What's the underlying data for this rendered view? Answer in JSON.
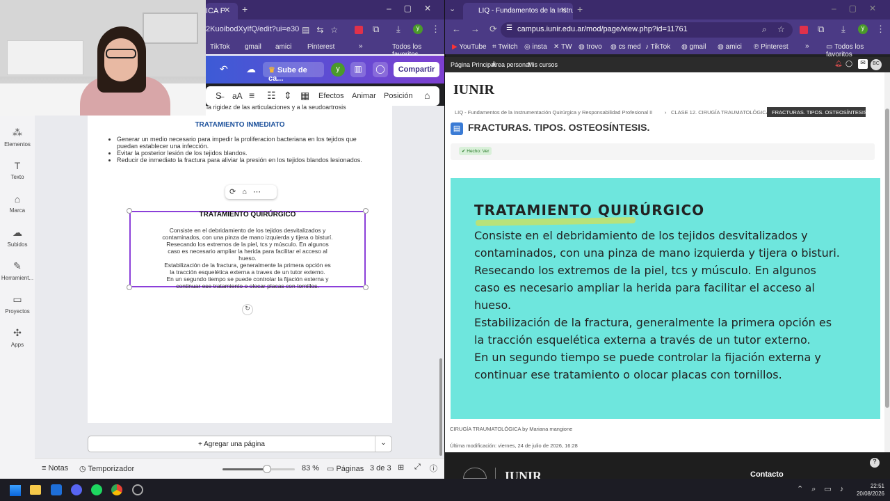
{
  "left_browser": {
    "tab_title": "ICA P",
    "url": "2KuoibodXyIfQ/edit?ui=e30",
    "bookmarks": [
      "TikTok",
      "gmail",
      "amici",
      "Pinterest"
    ],
    "bookmarks_all": "Todos los favoritos",
    "avatar_letter": "y"
  },
  "canva": {
    "upgrade_label": "Sube de ca...",
    "share_label": "Compartir",
    "avatar_letter": "y",
    "format_bar": {
      "effects": "Efectos",
      "animate": "Animar",
      "position": "Posición",
      "font_size": "aA"
    },
    "sidebar": [
      {
        "label": "Elementos",
        "icon": "elements-icon"
      },
      {
        "label": "Texto",
        "icon": "text-icon"
      },
      {
        "label": "Marca",
        "icon": "brand-icon"
      },
      {
        "label": "Subidos",
        "icon": "upload-icon"
      },
      {
        "label": "Herramient...",
        "icon": "tools-icon"
      },
      {
        "label": "Proyectos",
        "icon": "folder-icon"
      },
      {
        "label": "Apps",
        "icon": "apps-icon"
      }
    ],
    "page": {
      "top_text": "la rigidez de las articulaciones y a la seudoartrosis",
      "heading_1": "TRATAMIENTO INMEDIATO",
      "bullets": [
        "Generar un medio necesario para impedir la proliferacion bacteriana en los tejidos que puedan establecer una infección.",
        "Evitar la posterior lesión de los tejidos blandos.",
        "Reducir de inmediato la fractura para aliviar la presión en los tejidos blandos lesionados."
      ],
      "heading_2": "TRATAMIENTO QUIRÚRGICO",
      "paragraph_lines": [
        "Consiste en el debridamiento de los tejidos desvitalizados y",
        "contaminados, con una pinza de mano izquierda y tijera o bisturí.",
        "Resecando los extremos de la piel, tcs y músculo. En algunos",
        "caso es necesario ampliar la herida para facilitar el acceso al",
        "hueso.",
        "Estabilización de la fractura, generalmente la primera opción es",
        "la tracción esquelética externa a traves de un tutor externo.",
        "En un segundo tiempo se puede controlar la fijación externa y",
        "continuar ese tratamiento o olocar placas con tornillos."
      ]
    },
    "add_page_label": "+ Agregar una página",
    "bottom": {
      "notes": "Notas",
      "timer": "Temporizador",
      "zoom": "83 %",
      "zoom_fraction": 0.62,
      "pages_label": "Páginas",
      "page_count": "3 de 3"
    }
  },
  "right_browser": {
    "tab_title": "LIQ - Fundamentos de la Instru",
    "url": "campus.iunir.edu.ar/mod/page/view.php?id=11761",
    "bookmarks": [
      "YouTube",
      "Twitch",
      "insta",
      "TW",
      "trovo",
      "cs med",
      "TikTok",
      "gmail",
      "amici",
      "Pinterest"
    ],
    "bookmarks_all": "Todos los favoritos",
    "avatar_letter": "y"
  },
  "moodle": {
    "nav": [
      "Página Principal",
      "Área personal",
      "Mis cursos"
    ],
    "user_initials": "BC",
    "logo": "IUNIR",
    "breadcrumb": [
      "LIQ - Fundamentos de la Instrumentación Quirúrgica y Responsabilidad Profesional II",
      "CLASE 12. CIRUGÍA TRAUMATOLÓGICA",
      "FRACTURAS. TIPOS. OSTEOSÍNTESIS."
    ],
    "page_title": "FRACTURAS. TIPOS. OSTEOSÍNTESIS.",
    "done_badge": "✔ Hecho: Ver",
    "panel_heading": "TRATAMIENTO QUIRÚRGICO",
    "panel_lines": [
      "Consiste en el debridamiento de los tejidos desvitalizados y",
      "contaminados, con una pinza de mano izquierda y tijera o bisturi.",
      "Resecando los extremos de la piel, tcs y músculo. En algunos",
      "caso es necesario ampliar la herida para facilitar el acceso al",
      "hueso.",
      "Estabilización de la fractura, generalmente la primera opción es",
      "la tracción esquelética externa a través de un tutor externo.",
      "En un segundo tiempo se puede controlar la fijación externa y",
      "continuar ese tratamiento o olocar placas con tornillos."
    ],
    "author_line": "CIRUGÍA TRAUMATOLÓGICA by Mariana mangione",
    "modified_line": "Última modificación: viernes, 24 de julio de 2026, 16:28",
    "footer_contact": "Contacto",
    "footer_logo": "IUNIR"
  },
  "taskbar": {
    "time": "22:51",
    "date": "20/08/2026"
  },
  "colors": {
    "browser_purple": "#4b3a85",
    "panel_cyan": "#6ee6dd",
    "canva_accent": "#7d3fd0"
  }
}
